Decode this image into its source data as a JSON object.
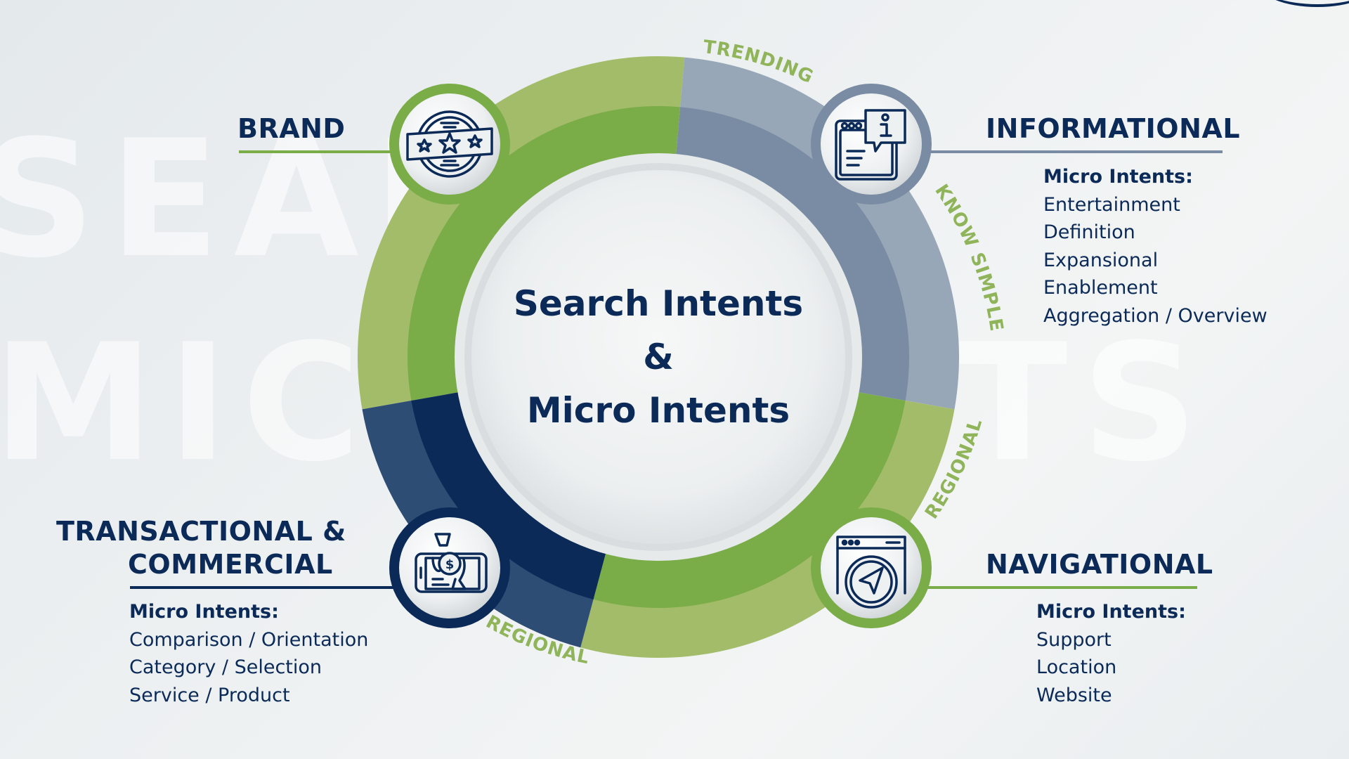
{
  "watermark": {
    "line1": "SEARCH",
    "line2": "MICRO",
    "line3": "NTS",
    "line4": "E"
  },
  "center": {
    "line1": "Search Intents",
    "line2": "&",
    "line3": "Micro Intents"
  },
  "arc_labels": {
    "top": "TRENDING",
    "right_upper": "KNOW SIMPLE",
    "right_lower": "REGIONAL",
    "bottom": "REGIONAL"
  },
  "colors": {
    "navy": "#0b2a57",
    "green": "#7aac48",
    "light_green": "#a3bc6a",
    "slate": "#7a8ca3",
    "light_slate": "#98a7b7",
    "dark_blue": "#2e4d74",
    "label_green": "#8fb45a"
  },
  "intents": [
    {
      "id": "brand",
      "title": "BRAND",
      "icon": "rating-badge-icon",
      "micro_heading": null,
      "micro_intents": []
    },
    {
      "id": "informational",
      "title": "INFORMATIONAL",
      "icon": "browser-info-icon",
      "micro_heading": "Micro Intents:",
      "micro_intents": [
        "Entertainment",
        "Definition",
        "Expansional",
        "Enablement",
        "Aggregation / Overview"
      ]
    },
    {
      "id": "transactional",
      "title_line1": "TRANSACTIONAL &",
      "title_line2": "COMMERCIAL",
      "icon": "mobile-payment-icon",
      "micro_heading": "Micro Intents:",
      "micro_intents": [
        "Comparison / Orientation",
        "Category / Selection",
        "Service / Product"
      ]
    },
    {
      "id": "navigational",
      "title": "NAVIGATIONAL",
      "icon": "browser-navigation-icon",
      "micro_heading": "Micro Intents:",
      "micro_intents": [
        "Support",
        "Location",
        "Website"
      ]
    }
  ]
}
